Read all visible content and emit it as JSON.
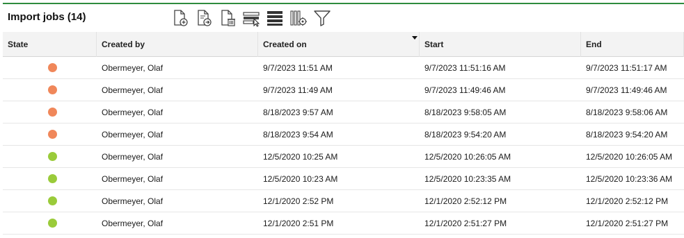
{
  "header": {
    "title": "Import jobs (14)"
  },
  "toolbar": {
    "buttons": [
      {
        "icon": "new-document-icon"
      },
      {
        "icon": "export-document-icon"
      },
      {
        "icon": "delete-document-icon"
      },
      {
        "icon": "select-rows-icon"
      },
      {
        "icon": "row-list-icon"
      },
      {
        "icon": "column-settings-icon"
      },
      {
        "icon": "filter-icon"
      }
    ]
  },
  "colors": {
    "accent_line": "#2e8b3e",
    "state_orange": "#f0875a",
    "state_green": "#9acb3a"
  },
  "table": {
    "columns": [
      "State",
      "Created by",
      "Created on",
      "Start",
      "End"
    ],
    "sorted_column": "Created on",
    "rows": [
      {
        "state": "orange",
        "created_by": "Obermeyer, Olaf",
        "created_on": "9/7/2023 11:51 AM",
        "start": "9/7/2023 11:51:16 AM",
        "end": "9/7/2023 11:51:17 AM"
      },
      {
        "state": "orange",
        "created_by": "Obermeyer, Olaf",
        "created_on": "9/7/2023 11:49 AM",
        "start": "9/7/2023 11:49:46 AM",
        "end": "9/7/2023 11:49:46 AM"
      },
      {
        "state": "orange",
        "created_by": "Obermeyer, Olaf",
        "created_on": "8/18/2023 9:57 AM",
        "start": "8/18/2023 9:58:05 AM",
        "end": "8/18/2023 9:58:06 AM"
      },
      {
        "state": "orange",
        "created_by": "Obermeyer, Olaf",
        "created_on": "8/18/2023 9:54 AM",
        "start": "8/18/2023 9:54:20 AM",
        "end": "8/18/2023 9:54:20 AM"
      },
      {
        "state": "green",
        "created_by": "Obermeyer, Olaf",
        "created_on": "12/5/2020 10:25 AM",
        "start": "12/5/2020 10:26:05 AM",
        "end": "12/5/2020 10:26:05 AM"
      },
      {
        "state": "green",
        "created_by": "Obermeyer, Olaf",
        "created_on": "12/5/2020 10:23 AM",
        "start": "12/5/2020 10:23:35 AM",
        "end": "12/5/2020 10:23:36 AM"
      },
      {
        "state": "green",
        "created_by": "Obermeyer, Olaf",
        "created_on": "12/1/2020 2:52 PM",
        "start": "12/1/2020 2:52:12 PM",
        "end": "12/1/2020 2:52:12 PM"
      },
      {
        "state": "green",
        "created_by": "Obermeyer, Olaf",
        "created_on": "12/1/2020 2:51 PM",
        "start": "12/1/2020 2:51:27 PM",
        "end": "12/1/2020 2:51:27 PM"
      }
    ]
  }
}
